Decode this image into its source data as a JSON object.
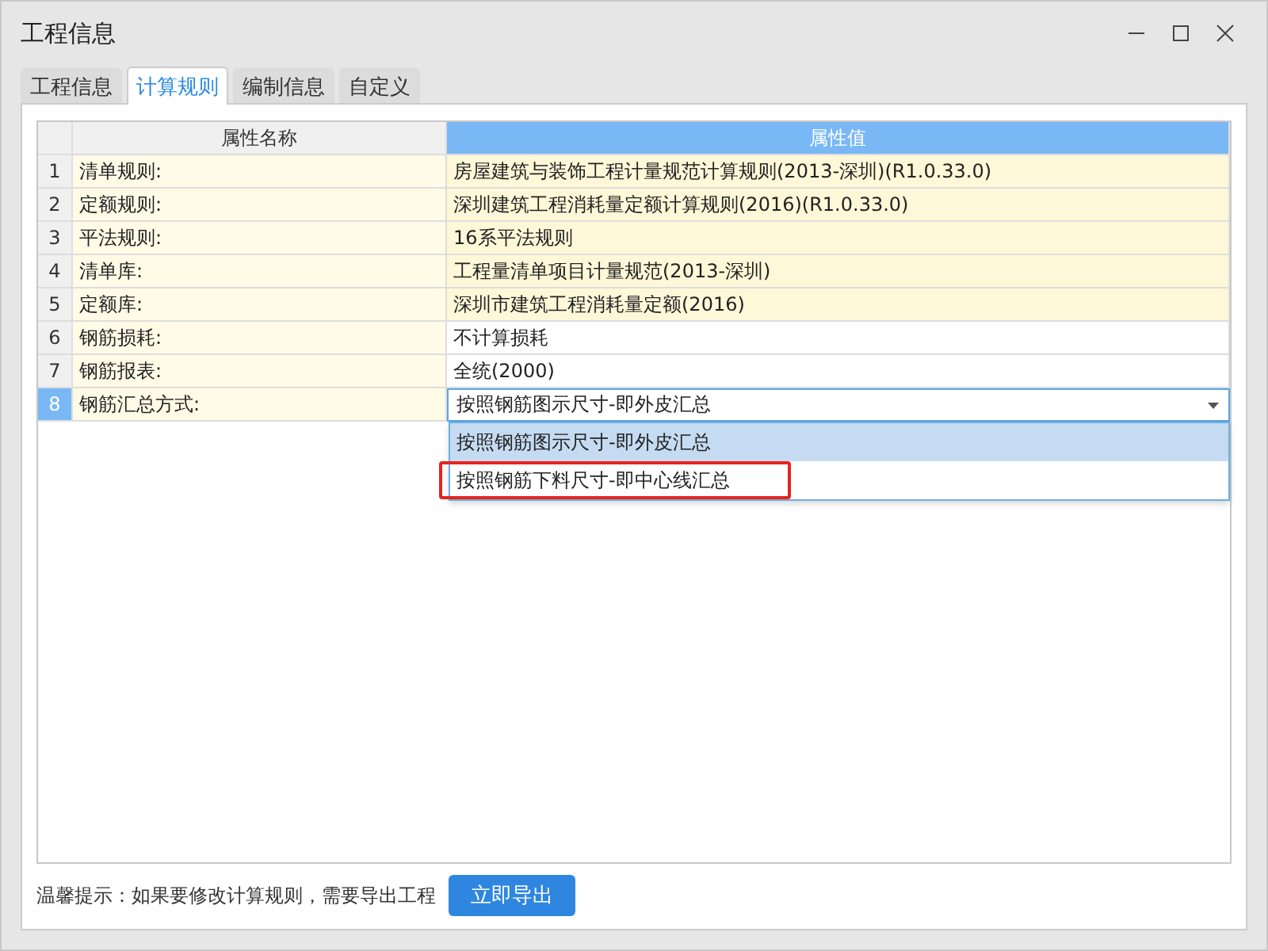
{
  "window": {
    "title": "工程信息"
  },
  "tabs": [
    {
      "label": "工程信息",
      "selected": false
    },
    {
      "label": "计算规则",
      "selected": true
    },
    {
      "label": "编制信息",
      "selected": false
    },
    {
      "label": "自定义",
      "selected": false
    }
  ],
  "table": {
    "columns": [
      "属性名称",
      "属性值"
    ],
    "rows": [
      {
        "index": "1",
        "name": "清单规则:",
        "value": "房屋建筑与装饰工程计量规范计算规则(2013-深圳)(R1.0.33.0)",
        "locked": true,
        "selected": false
      },
      {
        "index": "2",
        "name": "定额规则:",
        "value": "深圳建筑工程消耗量定额计算规则(2016)(R1.0.33.0)",
        "locked": true,
        "selected": false
      },
      {
        "index": "3",
        "name": "平法规则:",
        "value": "16系平法规则",
        "locked": true,
        "selected": false
      },
      {
        "index": "4",
        "name": "清单库:",
        "value": "工程量清单项目计量规范(2013-深圳)",
        "locked": true,
        "selected": false
      },
      {
        "index": "5",
        "name": "定额库:",
        "value": "深圳市建筑工程消耗量定额(2016)",
        "locked": true,
        "selected": false
      },
      {
        "index": "6",
        "name": "钢筋损耗:",
        "value": "不计算损耗",
        "locked": false,
        "selected": false
      },
      {
        "index": "7",
        "name": "钢筋报表:",
        "value": "全统(2000)",
        "locked": false,
        "selected": false
      },
      {
        "index": "8",
        "name": "钢筋汇总方式:",
        "value": "按照钢筋图示尺寸-即外皮汇总",
        "selected": true
      }
    ],
    "dropdown": {
      "expanded": true,
      "options": [
        {
          "label": "按照钢筋图示尺寸-即外皮汇总",
          "selected": true,
          "outlined": false
        },
        {
          "label": "按照钢筋下料尺寸-即中心线汇总",
          "selected": false,
          "outlined": true
        }
      ]
    }
  },
  "footer": {
    "hint": "温馨提示：如果要修改计算规则，需要导出工程",
    "button": "立即导出"
  }
}
